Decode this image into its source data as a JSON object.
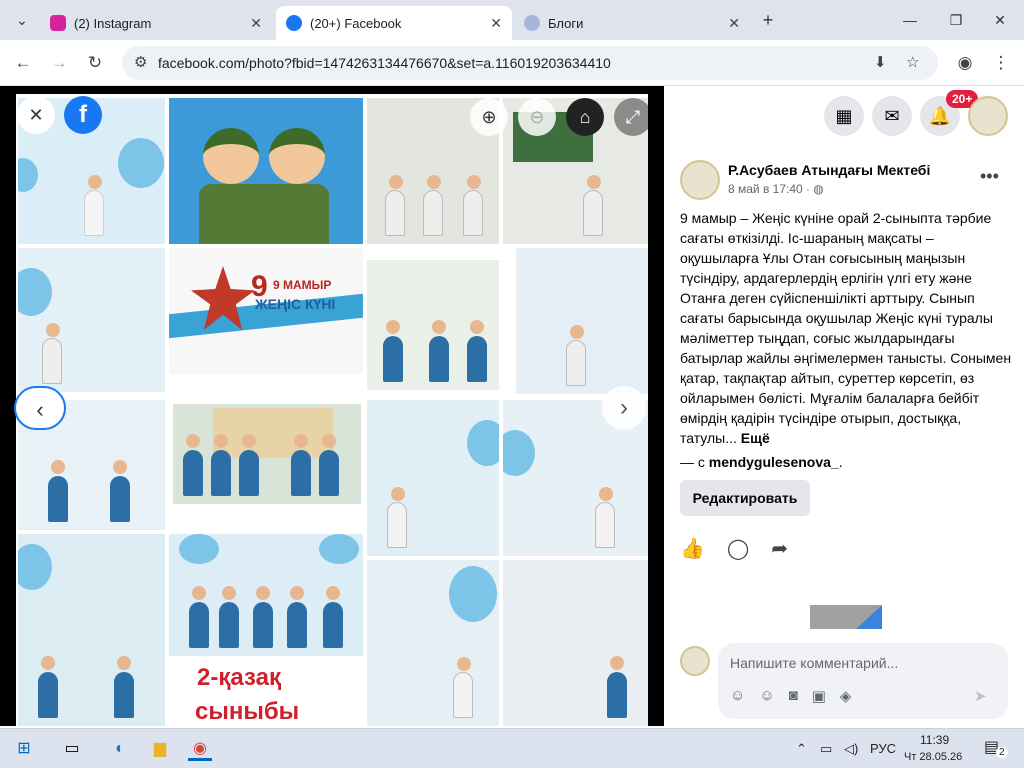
{
  "browser": {
    "tabs": [
      {
        "title": "(2) Instagram",
        "active": false
      },
      {
        "title": "(20+) Facebook",
        "active": true
      },
      {
        "title": "Блоги",
        "active": false
      }
    ],
    "url": "facebook.com/photo?fbid=1474263134476670&set=a.116019203634410"
  },
  "photo": {
    "banner_line1": "9 МАМЫР",
    "banner_line2": "ЖЕҢІС КҮНІ",
    "class_line1": "2-қазақ",
    "class_line2": "сыныбы"
  },
  "header": {
    "notifications_badge": "20+"
  },
  "post": {
    "author": "Р.Асубаев Атындағы Мектебі",
    "date": "8 май в 17:40 · ",
    "text": "9 мамыр – Жеңіс күніне орай 2-сыныпта тәрбие сағаты өткізілді. Іс-шараның мақсаты – оқушыларға Ұлы Отан соғысының маңызын түсіндіру, ардагерлердің ерлігін үлгі ету және Отанға деген сүйіспеншілікті арттыру. Сынып сағаты барысында оқушылар Жеңіс күні туралы мәліметтер тыңдап, соғыс жылдарындағы батырлар жайлы әңгімелермен танысты. Сонымен қатар, тақпақтар айтып, суреттер көрсетіп, өз ойларымен бөлісті. Мұғалім балаларға бейбіт өмірдің қадірін түсіндіре отырып, достыққа, татулы...",
    "more": "Ещё",
    "tagged_prefix": "— с ",
    "tagged_user": "mendygulesenova_",
    "tagged_suffix": ".",
    "edit_button": "Редактировать",
    "comment_placeholder": "Напишите комментарий..."
  },
  "taskbar": {
    "language": "РУС",
    "time": "11:39",
    "date": "Чт 28.05.26",
    "notifications": "2"
  }
}
